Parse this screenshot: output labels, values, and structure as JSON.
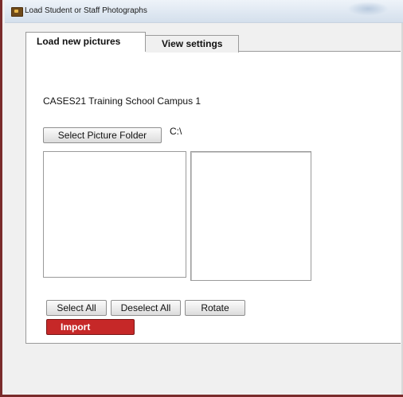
{
  "window": {
    "title": "Load Student or Staff Photographs",
    "icon": "folder-photo-icon"
  },
  "tabs": [
    {
      "label": "Load new pictures",
      "selected": true
    },
    {
      "label": "View settings",
      "selected": false
    }
  ],
  "main": {
    "school_name": "CASES21 Training School Campus 1",
    "select_folder_label": "Select Picture Folder",
    "folder_path": "C:\\",
    "file_list_items": [],
    "select_all_label": "Select All",
    "deselect_all_label": "Deselect All",
    "rotate_label": "Rotate",
    "import_label": "Import"
  },
  "colors": {
    "import_button": "#c62828",
    "window_border": "#7a2b2b"
  }
}
